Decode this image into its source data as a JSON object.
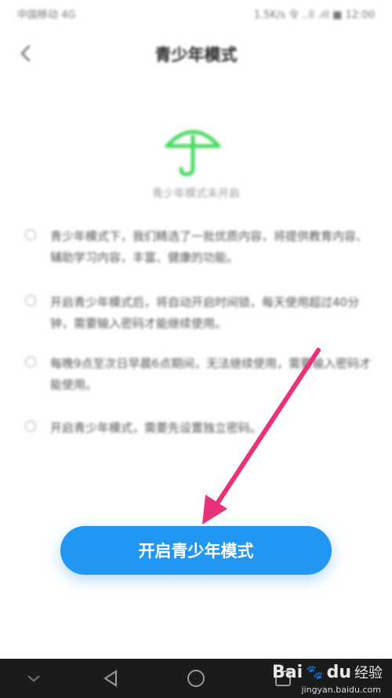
{
  "status_bar": {
    "carrier": "中国移动 4G",
    "right_text": "1.5K/s 令 ..ll .ıll ■ 12:00"
  },
  "header": {
    "back_icon": "chevron-left-icon",
    "title": "青少年模式"
  },
  "hero": {
    "icon": "umbrella-icon",
    "caption": "青少年模式未开启",
    "color": "#4cd964"
  },
  "tips": [
    {
      "text": "青少年模式下，我们精选了一批优质内容，将提供教育内容、辅助学习内容，丰富、健康的功能。"
    },
    {
      "text": "开启青少年模式后，将自动开启时间锁，每天使用超过40分钟，需要输入密码才能继续使用。"
    },
    {
      "text": "每晚9点至次日早晨6点期间，无法继续使用，需要输入密码才能使用。"
    },
    {
      "text": "开启青少年模式，需要先设置独立密码。"
    }
  ],
  "primary_button": {
    "label": "开启青少年模式",
    "color": "#2196f3"
  },
  "annotation": {
    "arrow_color": "#e8337a"
  },
  "nav_bar": {
    "items": [
      "down-icon",
      "back-triangle-icon",
      "home-circle-icon",
      "recents-square-icon"
    ]
  },
  "watermark": {
    "logo": "Bai",
    "logo_suffix": "du",
    "text": "经验",
    "url": "jingyan.baidu.com"
  }
}
